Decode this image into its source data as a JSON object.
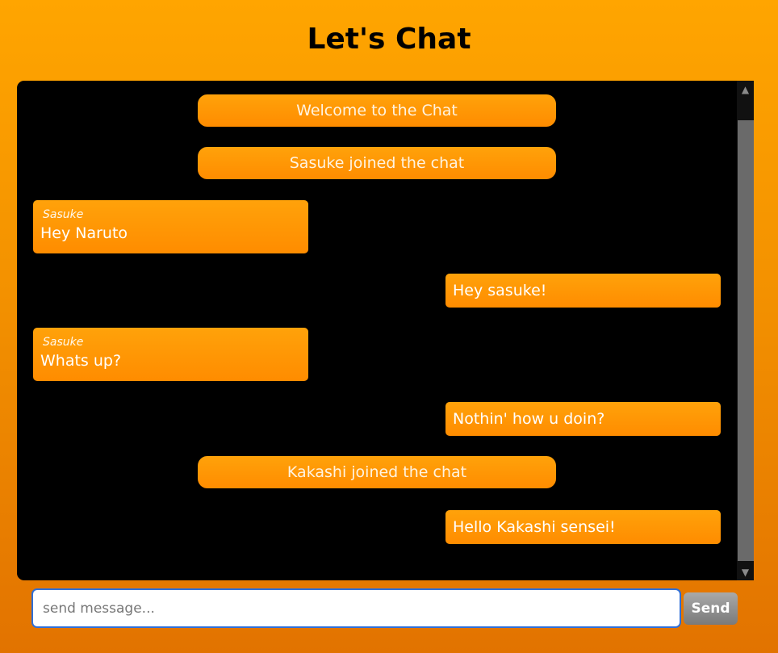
{
  "header": {
    "title": "Let's Chat"
  },
  "messages": [
    {
      "type": "system",
      "text": "Welcome to the Chat"
    },
    {
      "type": "system",
      "text": "Sasuke joined the chat"
    },
    {
      "type": "incoming",
      "sender": "Sasuke",
      "text": "Hey Naruto"
    },
    {
      "type": "outgoing",
      "text": "Hey sasuke!"
    },
    {
      "type": "incoming",
      "sender": "Sasuke",
      "text": "Whats up?"
    },
    {
      "type": "outgoing",
      "text": "Nothin' how u doin?"
    },
    {
      "type": "system",
      "text": "Kakashi joined the chat"
    },
    {
      "type": "outgoing",
      "text": "Hello Kakashi sensei!"
    }
  ],
  "composer": {
    "placeholder": "send message...",
    "value": "",
    "send_label": "Send"
  },
  "icons": {
    "scroll_up": "chevron-up-icon",
    "scroll_down": "chevron-down-icon"
  },
  "colors": {
    "background_top": "#ffa500",
    "background_bottom": "#e27300",
    "bubble": "#ff8c00",
    "chat_background": "#000000",
    "input_border": "#2f6fd8",
    "send_button": "#8a8a8a"
  }
}
